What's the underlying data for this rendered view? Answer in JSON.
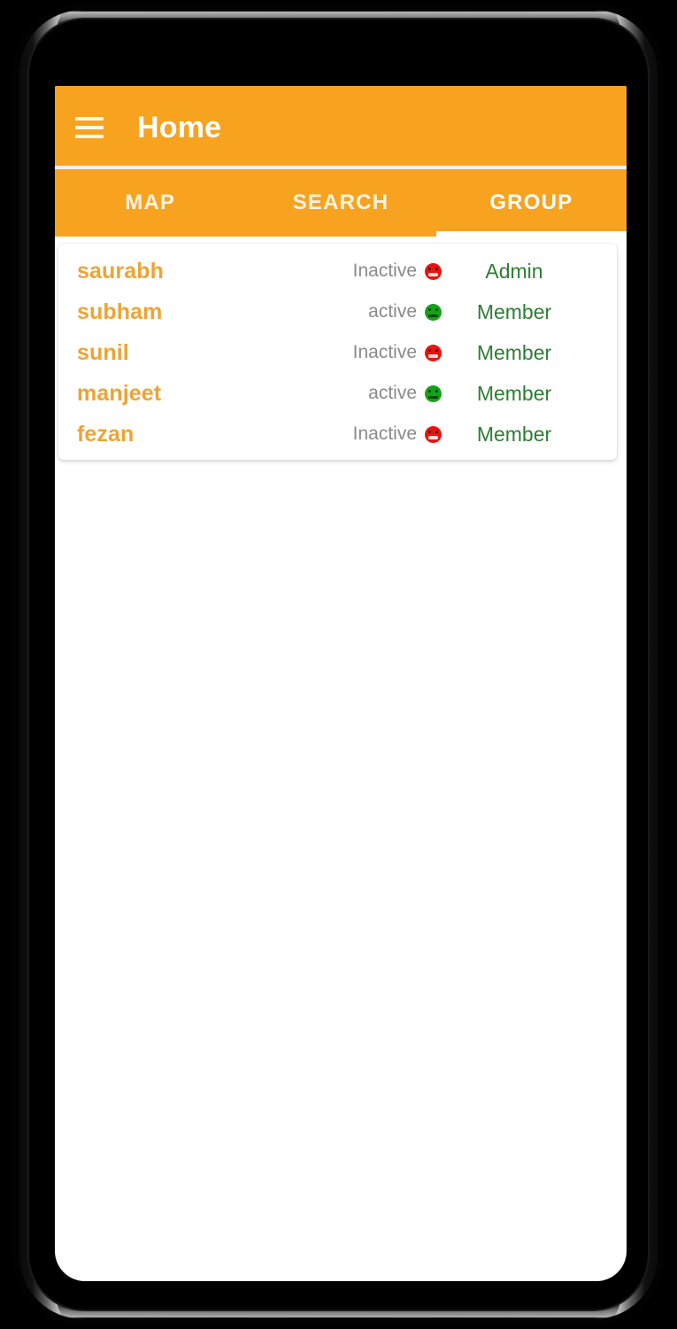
{
  "app": {
    "title": "Home",
    "menu_icon": "hamburger-menu-icon",
    "accent_color": "#F7A320",
    "name_color": "#EDA435",
    "role_color": "#2E7D32",
    "status_text_color": "#8A8A8A",
    "active_face_color": "#15A11A",
    "inactive_face_color": "#E8150F"
  },
  "tabs": {
    "items": [
      {
        "label": "MAP",
        "active": false
      },
      {
        "label": "SEARCH",
        "active": false
      },
      {
        "label": "GROUP",
        "active": true
      }
    ],
    "selected": "GROUP"
  },
  "group_list": {
    "members": [
      {
        "name": "saurabh",
        "status": "Inactive",
        "status_icon": "sad-face-icon",
        "role": "Admin"
      },
      {
        "name": "subham",
        "status": "active",
        "status_icon": "neutral-face-icon",
        "role": "Member"
      },
      {
        "name": "sunil",
        "status": "Inactive",
        "status_icon": "sad-face-icon",
        "role": "Member"
      },
      {
        "name": "manjeet",
        "status": "active",
        "status_icon": "neutral-face-icon",
        "role": "Member"
      },
      {
        "name": "fezan",
        "status": "Inactive",
        "status_icon": "sad-face-icon",
        "role": "Member"
      }
    ]
  }
}
